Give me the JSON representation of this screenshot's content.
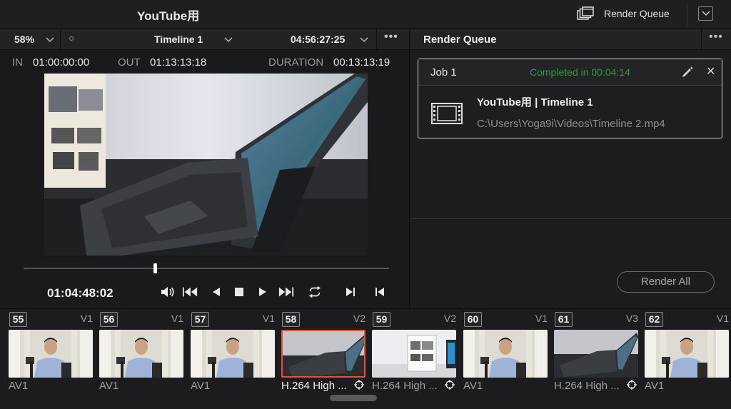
{
  "topbar": {
    "project_title": "YouTube用",
    "render_queue_label": "Render Queue"
  },
  "viewer": {
    "zoom": "58%",
    "timeline_name": "Timeline 1",
    "timecode": "04:56:27:25",
    "in_label": "IN",
    "in_value": "01:00:00:00",
    "out_label": "OUT",
    "out_value": "01:13:13:18",
    "duration_label": "DURATION",
    "duration_value": "00:13:13:19",
    "current_timecode": "01:04:48:02",
    "playhead_progress": 0.36
  },
  "render_queue": {
    "title": "Render Queue",
    "jobs": [
      {
        "name": "Job 1",
        "status": "Completed in 00:04:14",
        "title": "YouTube用 | Timeline 1",
        "path": "C:\\Users\\Yoga9i\\Videos\\Timeline 2.mp4"
      }
    ],
    "render_all_label": "Render All"
  },
  "clips": [
    {
      "num": "55",
      "track": "V1",
      "codec": "AV1",
      "kind": "person",
      "selected": false
    },
    {
      "num": "56",
      "track": "V1",
      "codec": "AV1",
      "kind": "person",
      "selected": false
    },
    {
      "num": "57",
      "track": "V1",
      "codec": "AV1",
      "kind": "person",
      "selected": false
    },
    {
      "num": "58",
      "track": "V2",
      "codec": "H.264 High ...",
      "kind": "laptop",
      "selected": true
    },
    {
      "num": "59",
      "track": "V2",
      "codec": "H.264 High ...",
      "kind": "box",
      "selected": false
    },
    {
      "num": "60",
      "track": "V1",
      "codec": "AV1",
      "kind": "person",
      "selected": false
    },
    {
      "num": "61",
      "track": "V3",
      "codec": "H.264 High ...",
      "kind": "laptop",
      "selected": false
    },
    {
      "num": "62",
      "track": "V1",
      "codec": "AV1",
      "kind": "person",
      "selected": false
    }
  ],
  "colors": {
    "status_green": "#2a9d3f",
    "selected_clip": "#e0533d",
    "panel_bg": "#1c1c1e"
  }
}
